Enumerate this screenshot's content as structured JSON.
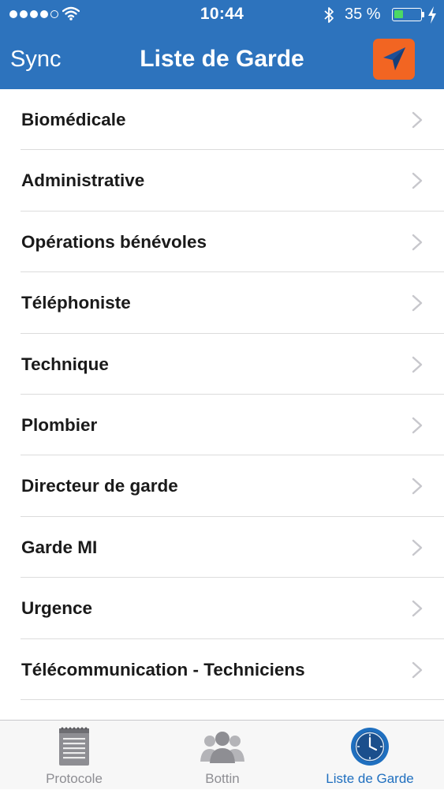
{
  "status_bar": {
    "time": "10:44",
    "battery_percent_text": "35 %",
    "battery_level": 0.35,
    "signal_bars_filled": 4,
    "signal_bars_total": 5,
    "battery_fill_color": "#4cd964"
  },
  "nav": {
    "sync_label": "Sync",
    "title": "Liste de Garde",
    "locate_icon": "location-arrow-icon",
    "accent_color": "#f26522",
    "background_color": "#2d73bd"
  },
  "list": {
    "items": [
      {
        "label": "Biomédicale"
      },
      {
        "label": "Administrative"
      },
      {
        "label": "Opérations bénévoles"
      },
      {
        "label": "Téléphoniste"
      },
      {
        "label": "Technique"
      },
      {
        "label": "Plombier"
      },
      {
        "label": "Directeur de garde"
      },
      {
        "label": "Garde MI"
      },
      {
        "label": "Urgence"
      },
      {
        "label": "Télécommunication - Techniciens"
      },
      {
        "label": ""
      }
    ]
  },
  "tab_bar": {
    "tabs": [
      {
        "label": "Protocole",
        "icon": "notepad-icon",
        "active": false
      },
      {
        "label": "Bottin",
        "icon": "people-icon",
        "active": false
      },
      {
        "label": "Liste de Garde",
        "icon": "clock-icon",
        "active": true
      }
    ],
    "active_color": "#1f6fbf",
    "inactive_color": "#8e8e93"
  }
}
